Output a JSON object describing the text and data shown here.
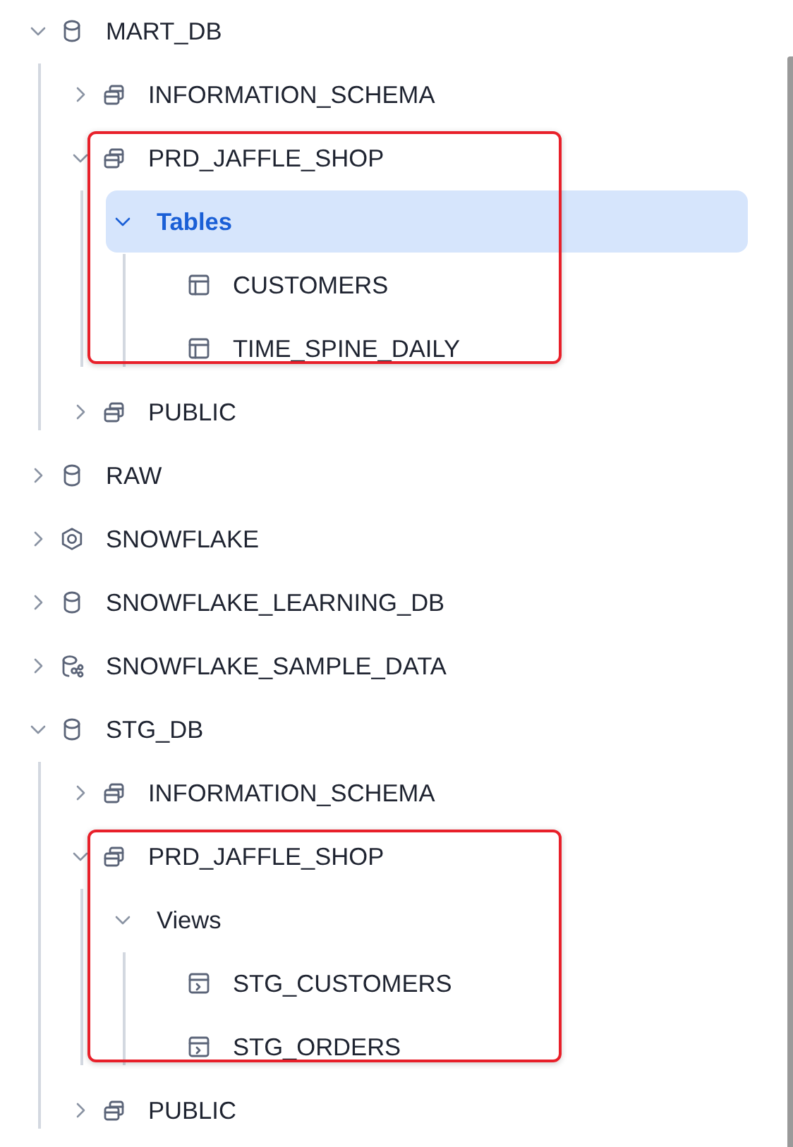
{
  "tree": [
    {
      "label": "MART_DB",
      "kind": "database",
      "expanded": true,
      "selected": false,
      "highlighted": false,
      "children": [
        {
          "label": "INFORMATION_SCHEMA",
          "kind": "schema",
          "expanded": false,
          "selected": false,
          "highlighted": false
        },
        {
          "label": "PRD_JAFFLE_SHOP",
          "kind": "schema",
          "expanded": true,
          "selected": false,
          "highlighted": true,
          "children": [
            {
              "label": "Tables",
              "kind": "folder",
              "expanded": true,
              "selected": true,
              "highlighted": false,
              "children": [
                {
                  "label": "CUSTOMERS",
                  "kind": "table",
                  "selected": false,
                  "highlighted": false
                },
                {
                  "label": "TIME_SPINE_DAILY",
                  "kind": "table",
                  "selected": false,
                  "highlighted": false
                }
              ]
            }
          ]
        },
        {
          "label": "PUBLIC",
          "kind": "schema",
          "expanded": false,
          "selected": false,
          "highlighted": false
        }
      ]
    },
    {
      "label": "RAW",
      "kind": "database",
      "expanded": false,
      "selected": false,
      "highlighted": false
    },
    {
      "label": "SNOWFLAKE",
      "kind": "app",
      "expanded": false,
      "selected": false,
      "highlighted": false
    },
    {
      "label": "SNOWFLAKE_LEARNING_DB",
      "kind": "database",
      "expanded": false,
      "selected": false,
      "highlighted": false
    },
    {
      "label": "SNOWFLAKE_SAMPLE_DATA",
      "kind": "shared",
      "expanded": false,
      "selected": false,
      "highlighted": false
    },
    {
      "label": "STG_DB",
      "kind": "database",
      "expanded": true,
      "selected": false,
      "highlighted": false,
      "children": [
        {
          "label": "INFORMATION_SCHEMA",
          "kind": "schema",
          "expanded": false,
          "selected": false,
          "highlighted": false
        },
        {
          "label": "PRD_JAFFLE_SHOP",
          "kind": "schema",
          "expanded": true,
          "selected": false,
          "highlighted": true,
          "children": [
            {
              "label": "Views",
              "kind": "folder",
              "expanded": true,
              "selected": false,
              "highlighted": false,
              "children": [
                {
                  "label": "STG_CUSTOMERS",
                  "kind": "view",
                  "selected": false,
                  "highlighted": false
                },
                {
                  "label": "STG_ORDERS",
                  "kind": "view",
                  "selected": false,
                  "highlighted": false
                }
              ]
            }
          ]
        },
        {
          "label": "PUBLIC",
          "kind": "schema",
          "expanded": false,
          "selected": false,
          "highlighted": false
        }
      ]
    }
  ]
}
